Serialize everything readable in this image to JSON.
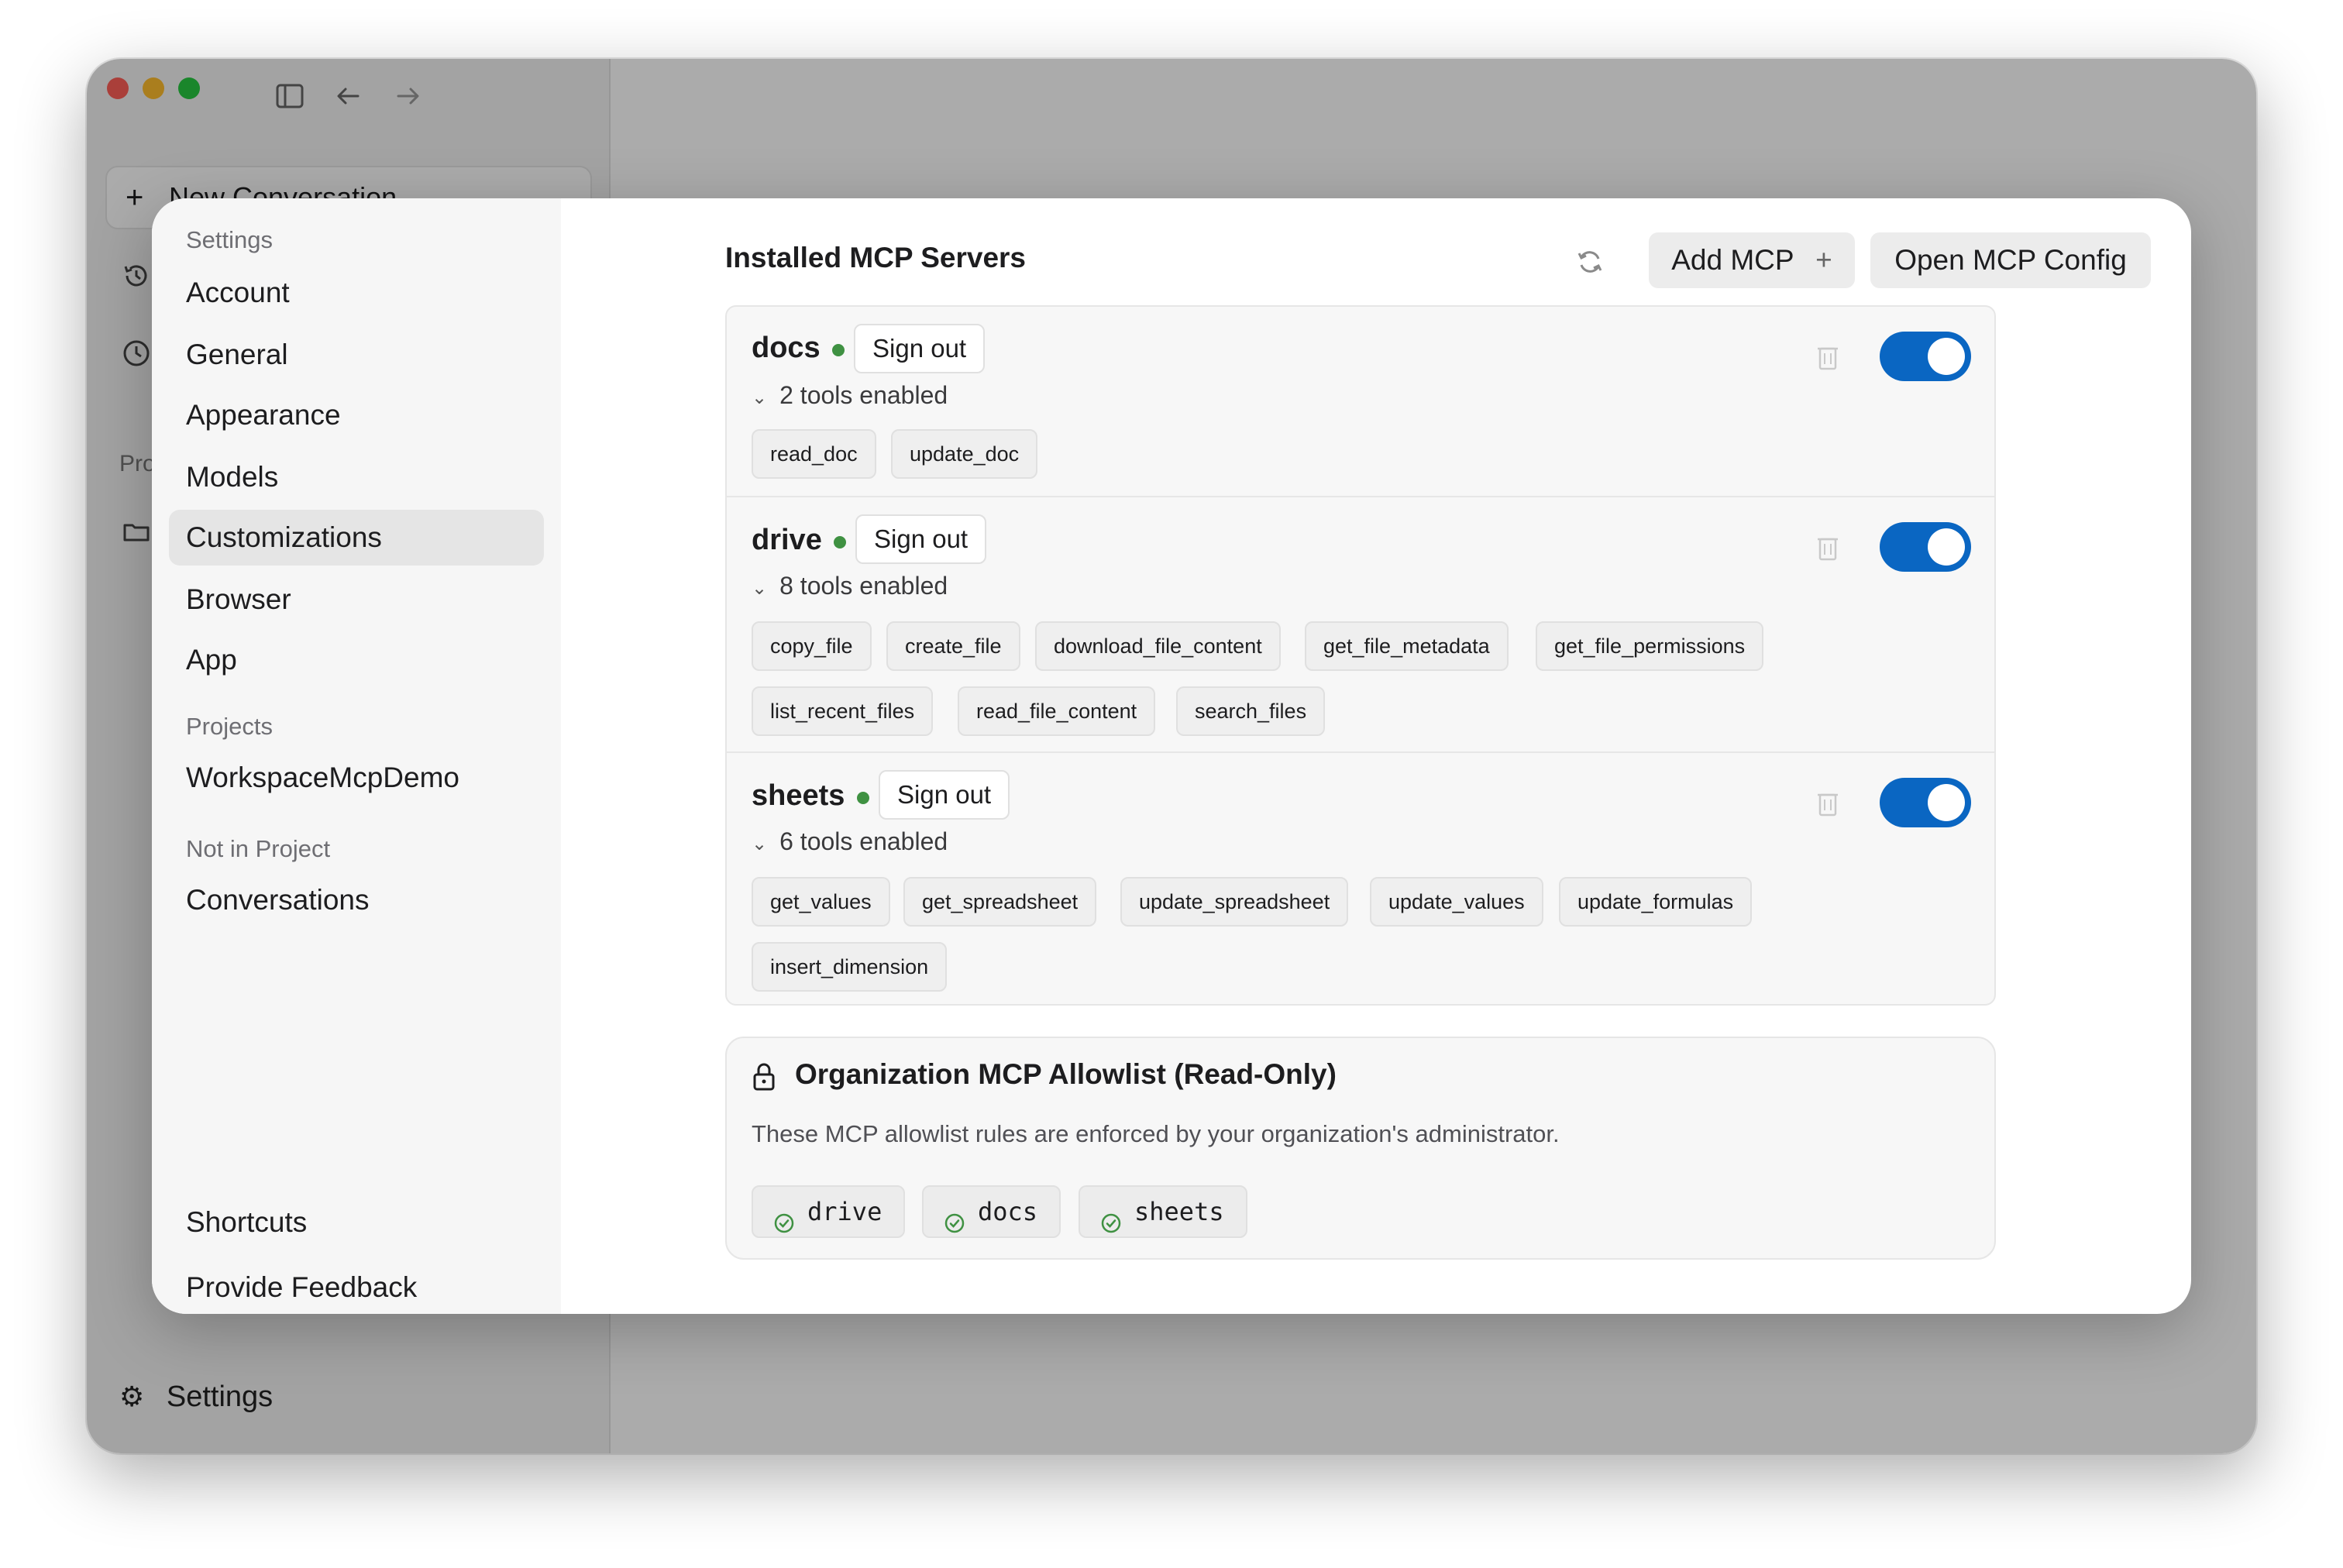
{
  "app": {
    "new_conversation_label": "New Conversation",
    "sidebar_partial_label": "Pro",
    "settings_label": "Settings"
  },
  "settings_nav": {
    "section_settings": "Settings",
    "items": [
      "Account",
      "General",
      "Appearance",
      "Models",
      "Customizations",
      "Browser",
      "App"
    ],
    "active_item": "Customizations",
    "section_projects": "Projects",
    "project_items": [
      "WorkspaceMcpDemo"
    ],
    "section_not_in_project": "Not in Project",
    "not_in_project_items": [
      "Conversations"
    ],
    "bottom_items": [
      "Shortcuts",
      "Provide Feedback"
    ]
  },
  "content": {
    "title": "Installed MCP Servers",
    "add_mcp_label": "Add MCP",
    "add_mcp_symbol": "+",
    "open_config_label": "Open MCP Config"
  },
  "servers": [
    {
      "name": "docs",
      "status": "connected",
      "sign_out_label": "Sign out",
      "tools_summary": "2 tools enabled",
      "enabled": true,
      "tools": [
        "read_doc",
        "update_doc"
      ]
    },
    {
      "name": "drive",
      "status": "connected",
      "sign_out_label": "Sign out",
      "tools_summary": "8 tools enabled",
      "enabled": true,
      "tools": [
        "copy_file",
        "create_file",
        "download_file_content",
        "get_file_metadata",
        "get_file_permissions",
        "list_recent_files",
        "read_file_content",
        "search_files"
      ]
    },
    {
      "name": "sheets",
      "status": "connected",
      "sign_out_label": "Sign out",
      "tools_summary": "6 tools enabled",
      "enabled": true,
      "tools": [
        "get_values",
        "get_spreadsheet",
        "update_spreadsheet",
        "update_values",
        "update_formulas",
        "insert_dimension"
      ]
    }
  ],
  "allowlist": {
    "title": "Organization MCP Allowlist (Read-Only)",
    "description": "These MCP allowlist rules are enforced by your organization's administrator.",
    "items": [
      "drive",
      "docs",
      "sheets"
    ]
  },
  "colors": {
    "toggle_on": "#0a66c2",
    "status_connected": "#3f9142",
    "allowlist_check": "#3f9142"
  },
  "icons": {
    "close": "close-icon",
    "refresh": "refresh-icon",
    "lock": "lock-icon",
    "trash": "trash-icon",
    "chevron": "chevron-down-icon",
    "check": "check-circle-icon"
  }
}
